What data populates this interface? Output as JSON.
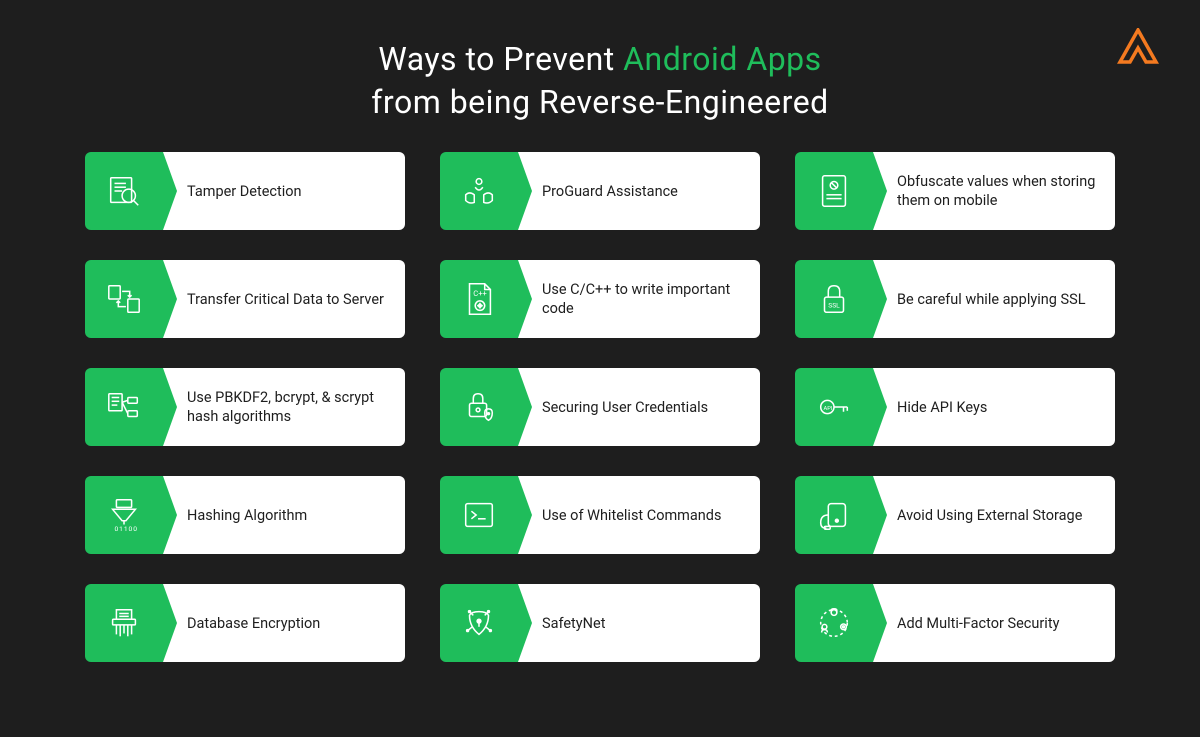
{
  "title": {
    "part1": "Ways to Prevent ",
    "accent": "Android Apps",
    "part2": "from being Reverse-Engineered"
  },
  "accent_color": "#1fbd5b",
  "logo_color": "#f47a20",
  "tiles": [
    {
      "icon": "search-document-icon",
      "label": "Tamper Detection"
    },
    {
      "icon": "hands-care-icon",
      "label": "ProGuard Assistance"
    },
    {
      "icon": "obfuscate-icon",
      "label": "Obfuscate values when storing them on mobile"
    },
    {
      "icon": "server-transfer-icon",
      "label": "Transfer Critical Data to Server"
    },
    {
      "icon": "cpp-file-icon",
      "label": "Use C/C++ to write important code"
    },
    {
      "icon": "ssl-lock-icon",
      "label": "Be careful while applying SSL"
    },
    {
      "icon": "algorithm-icon",
      "label": "Use PBKDF2, bcrypt, & scrypt hash algorithms"
    },
    {
      "icon": "shield-lock-icon",
      "label": "Securing User Credentials"
    },
    {
      "icon": "api-key-icon",
      "label": "Hide API Keys"
    },
    {
      "icon": "hash-funnel-icon",
      "label": "Hashing Algorithm"
    },
    {
      "icon": "terminal-icon",
      "label": "Use of Whitelist Commands"
    },
    {
      "icon": "external-drive-icon",
      "label": "Avoid Using External Storage"
    },
    {
      "icon": "shredder-icon",
      "label": "Database Encryption"
    },
    {
      "icon": "safetynet-icon",
      "label": "SafetyNet"
    },
    {
      "icon": "multifactor-icon",
      "label": "Add Multi-Factor Security"
    }
  ]
}
